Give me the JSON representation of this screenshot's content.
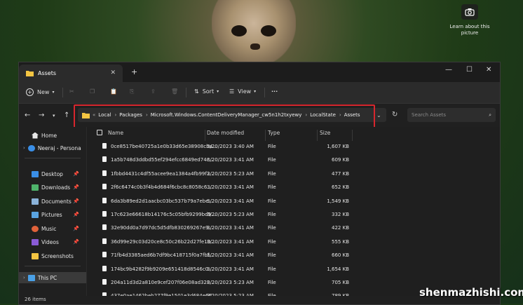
{
  "desktop": {
    "camera_label": "Learn about this picture"
  },
  "window": {
    "tab_title": "Assets",
    "new_tab": "+",
    "controls": {
      "minimize": "—",
      "maximize": "☐",
      "close": "✕"
    }
  },
  "toolbar": {
    "new": "New",
    "sort": "Sort",
    "view": "View",
    "more": "···"
  },
  "address": {
    "overflow": "«",
    "crumbs": [
      "Local",
      "Packages",
      "Microsoft.Windows.ContentDeliveryManager_cw5n1h2txyewy",
      "LocalState",
      "Assets"
    ],
    "search_placeholder": "Search Assets"
  },
  "sidebar": {
    "items": [
      "Home",
      "Neeraj - Persona",
      "Desktop",
      "Downloads",
      "Documents",
      "Pictures",
      "Music",
      "Videos",
      "Screenshots",
      "This PC"
    ]
  },
  "columns": [
    "Name",
    "Date modified",
    "Type",
    "Size"
  ],
  "files": [
    [
      "0ce8517be40725a1e0b33d65e38908cba...",
      "3/20/2023 3:40 AM",
      "File",
      "1,607 KB"
    ],
    [
      "1a5b748d3ddbd55ef294efcc6849ed74c...",
      "3/20/2023 3:41 AM",
      "File",
      "609 KB"
    ],
    [
      "1fbbd4431c4df55acee9ea1384a4fb99f2...",
      "3/20/2023 5:23 AM",
      "File",
      "477 KB"
    ],
    [
      "2f6c6474c0b3f4b4d684f6cbc8c8058c6...",
      "3/20/2023 3:41 AM",
      "File",
      "652 KB"
    ],
    [
      "6da3b89ed2d1aacbc03bc537b79a7ebe...",
      "3/20/2023 3:41 AM",
      "File",
      "1,549 KB"
    ],
    [
      "17c623e66618b14176c5c05bfb9299bd9...",
      "3/20/2023 5:23 AM",
      "File",
      "332 KB"
    ],
    [
      "32e90dd0a7d97dc5d5dfb830269267e9...",
      "3/20/2023 3:41 AM",
      "File",
      "422 KB"
    ],
    [
      "36d99e29c03d20ce8c50c26b22d27fe10...",
      "3/20/2023 3:41 AM",
      "File",
      "555 KB"
    ],
    [
      "71fb4d3385aed6b7df9bc418715f0a7fbf...",
      "3/20/2023 3:41 AM",
      "File",
      "660 KB"
    ],
    [
      "174bc9b4282f9b9209e651418d8546c0...",
      "3/20/2023 3:41 AM",
      "File",
      "1,654 KB"
    ],
    [
      "204a11d3d2a810e9cef207f06e08ad328...",
      "3/20/2023 5:23 AM",
      "File",
      "705 KB"
    ],
    [
      "437e0ae1462beb277f9e1501e3d684e66...",
      "3/20/2023 5:23 AM",
      "File",
      "789 KB"
    ]
  ],
  "status": {
    "count": "26 items"
  },
  "watermark": "shenmazhishi.com",
  "colors": {
    "highlight": "#d8262e",
    "folder": "#f4c542"
  }
}
